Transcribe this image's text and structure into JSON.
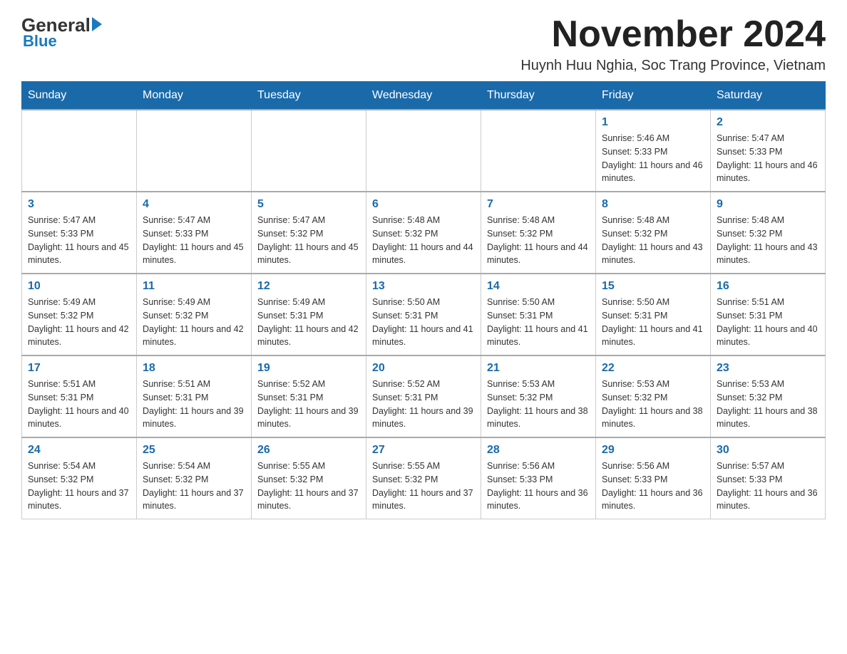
{
  "logo": {
    "general": "General",
    "blue": "Blue",
    "sub": "Blue"
  },
  "header": {
    "month_title": "November 2024",
    "subtitle": "Huynh Huu Nghia, Soc Trang Province, Vietnam"
  },
  "columns": [
    "Sunday",
    "Monday",
    "Tuesday",
    "Wednesday",
    "Thursday",
    "Friday",
    "Saturday"
  ],
  "weeks": [
    [
      {
        "day": "",
        "info": ""
      },
      {
        "day": "",
        "info": ""
      },
      {
        "day": "",
        "info": ""
      },
      {
        "day": "",
        "info": ""
      },
      {
        "day": "",
        "info": ""
      },
      {
        "day": "1",
        "info": "Sunrise: 5:46 AM\nSunset: 5:33 PM\nDaylight: 11 hours and 46 minutes."
      },
      {
        "day": "2",
        "info": "Sunrise: 5:47 AM\nSunset: 5:33 PM\nDaylight: 11 hours and 46 minutes."
      }
    ],
    [
      {
        "day": "3",
        "info": "Sunrise: 5:47 AM\nSunset: 5:33 PM\nDaylight: 11 hours and 45 minutes."
      },
      {
        "day": "4",
        "info": "Sunrise: 5:47 AM\nSunset: 5:33 PM\nDaylight: 11 hours and 45 minutes."
      },
      {
        "day": "5",
        "info": "Sunrise: 5:47 AM\nSunset: 5:32 PM\nDaylight: 11 hours and 45 minutes."
      },
      {
        "day": "6",
        "info": "Sunrise: 5:48 AM\nSunset: 5:32 PM\nDaylight: 11 hours and 44 minutes."
      },
      {
        "day": "7",
        "info": "Sunrise: 5:48 AM\nSunset: 5:32 PM\nDaylight: 11 hours and 44 minutes."
      },
      {
        "day": "8",
        "info": "Sunrise: 5:48 AM\nSunset: 5:32 PM\nDaylight: 11 hours and 43 minutes."
      },
      {
        "day": "9",
        "info": "Sunrise: 5:48 AM\nSunset: 5:32 PM\nDaylight: 11 hours and 43 minutes."
      }
    ],
    [
      {
        "day": "10",
        "info": "Sunrise: 5:49 AM\nSunset: 5:32 PM\nDaylight: 11 hours and 42 minutes."
      },
      {
        "day": "11",
        "info": "Sunrise: 5:49 AM\nSunset: 5:32 PM\nDaylight: 11 hours and 42 minutes."
      },
      {
        "day": "12",
        "info": "Sunrise: 5:49 AM\nSunset: 5:31 PM\nDaylight: 11 hours and 42 minutes."
      },
      {
        "day": "13",
        "info": "Sunrise: 5:50 AM\nSunset: 5:31 PM\nDaylight: 11 hours and 41 minutes."
      },
      {
        "day": "14",
        "info": "Sunrise: 5:50 AM\nSunset: 5:31 PM\nDaylight: 11 hours and 41 minutes."
      },
      {
        "day": "15",
        "info": "Sunrise: 5:50 AM\nSunset: 5:31 PM\nDaylight: 11 hours and 41 minutes."
      },
      {
        "day": "16",
        "info": "Sunrise: 5:51 AM\nSunset: 5:31 PM\nDaylight: 11 hours and 40 minutes."
      }
    ],
    [
      {
        "day": "17",
        "info": "Sunrise: 5:51 AM\nSunset: 5:31 PM\nDaylight: 11 hours and 40 minutes."
      },
      {
        "day": "18",
        "info": "Sunrise: 5:51 AM\nSunset: 5:31 PM\nDaylight: 11 hours and 39 minutes."
      },
      {
        "day": "19",
        "info": "Sunrise: 5:52 AM\nSunset: 5:31 PM\nDaylight: 11 hours and 39 minutes."
      },
      {
        "day": "20",
        "info": "Sunrise: 5:52 AM\nSunset: 5:31 PM\nDaylight: 11 hours and 39 minutes."
      },
      {
        "day": "21",
        "info": "Sunrise: 5:53 AM\nSunset: 5:32 PM\nDaylight: 11 hours and 38 minutes."
      },
      {
        "day": "22",
        "info": "Sunrise: 5:53 AM\nSunset: 5:32 PM\nDaylight: 11 hours and 38 minutes."
      },
      {
        "day": "23",
        "info": "Sunrise: 5:53 AM\nSunset: 5:32 PM\nDaylight: 11 hours and 38 minutes."
      }
    ],
    [
      {
        "day": "24",
        "info": "Sunrise: 5:54 AM\nSunset: 5:32 PM\nDaylight: 11 hours and 37 minutes."
      },
      {
        "day": "25",
        "info": "Sunrise: 5:54 AM\nSunset: 5:32 PM\nDaylight: 11 hours and 37 minutes."
      },
      {
        "day": "26",
        "info": "Sunrise: 5:55 AM\nSunset: 5:32 PM\nDaylight: 11 hours and 37 minutes."
      },
      {
        "day": "27",
        "info": "Sunrise: 5:55 AM\nSunset: 5:32 PM\nDaylight: 11 hours and 37 minutes."
      },
      {
        "day": "28",
        "info": "Sunrise: 5:56 AM\nSunset: 5:33 PM\nDaylight: 11 hours and 36 minutes."
      },
      {
        "day": "29",
        "info": "Sunrise: 5:56 AM\nSunset: 5:33 PM\nDaylight: 11 hours and 36 minutes."
      },
      {
        "day": "30",
        "info": "Sunrise: 5:57 AM\nSunset: 5:33 PM\nDaylight: 11 hours and 36 minutes."
      }
    ]
  ]
}
